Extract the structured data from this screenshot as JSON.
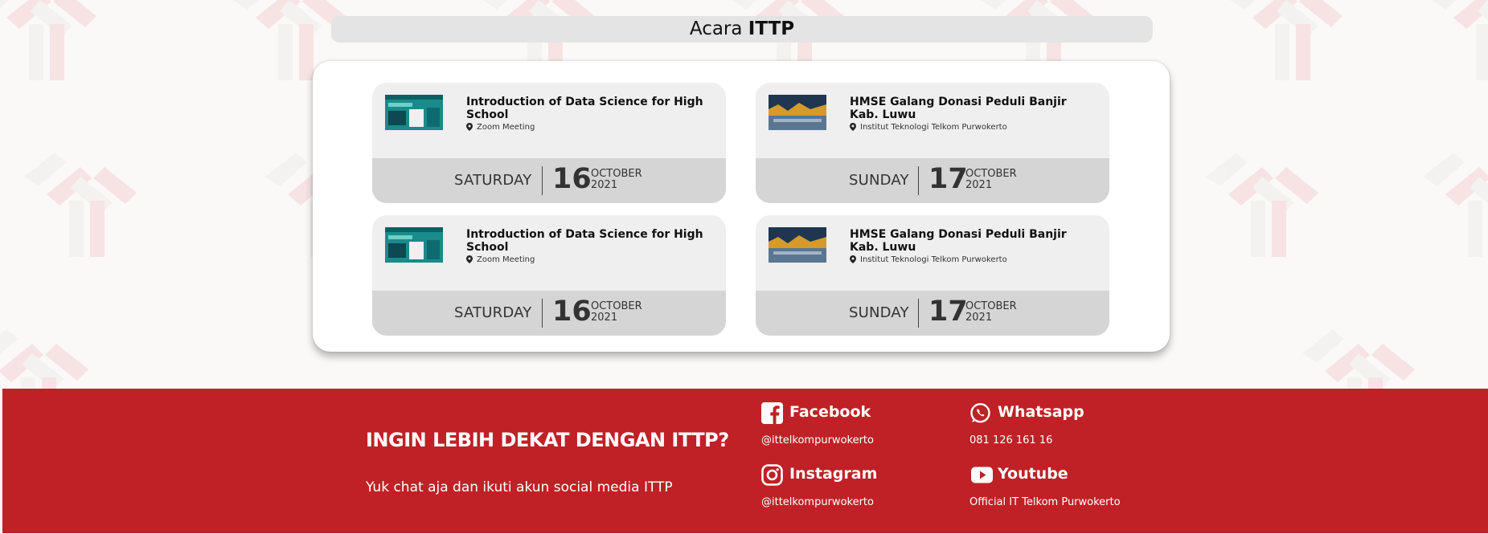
{
  "page": {
    "title_prefix": "Acara",
    "title_strong": "ITTP"
  },
  "events": [
    {
      "title": "Introduction of Data Science for High School",
      "location": "Zoom Meeting",
      "thumb_icon": "data-science-poster-thumbnail",
      "day": "SATURDAY",
      "date": "16",
      "month": "OCTOBER",
      "year": "2021"
    },
    {
      "title": "HMSE Galang Donasi Peduli Banjir Kab. Luwu",
      "location": "Institut Teknologi Telkom Purwokerto",
      "thumb_icon": "flood-donation-poster-thumbnail",
      "day": "SUNDAY",
      "date": "17",
      "month": "OCTOBER",
      "year": "2021"
    },
    {
      "title": "Introduction of Data Science for High School",
      "location": "Zoom Meeting",
      "thumb_icon": "data-science-poster-thumbnail",
      "day": "SATURDAY",
      "date": "16",
      "month": "OCTOBER",
      "year": "2021"
    },
    {
      "title": "HMSE Galang Donasi Peduli Banjir Kab. Luwu",
      "location": "Institut Teknologi Telkom Purwokerto",
      "thumb_icon": "flood-donation-poster-thumbnail",
      "day": "SUNDAY",
      "date": "17",
      "month": "OCTOBER",
      "year": "2021"
    }
  ],
  "footer": {
    "headline": "INGIN LEBIH DEKAT DENGAN ITTP?",
    "subtext": "Yuk chat aja dan ikuti akun social media ITTP",
    "social": {
      "facebook": {
        "name": "Facebook",
        "handle": "@ittelkompurwokerto",
        "icon": "facebook-icon"
      },
      "whatsapp": {
        "name": "Whatsapp",
        "handle": "081 126 161 16",
        "icon": "whatsapp-icon"
      },
      "instagram": {
        "name": "Instagram",
        "handle": "@ittelkompurwokerto",
        "icon": "instagram-icon"
      },
      "youtube": {
        "name": "Youtube",
        "handle": "Official IT Telkom Purwokerto",
        "icon": "youtube-icon"
      }
    }
  },
  "colors": {
    "footer_bg": "#bf2126",
    "card_bg": "#efefef",
    "date_bar_bg": "#d5d5d5",
    "title_bar_bg": "#e4e4e4"
  }
}
